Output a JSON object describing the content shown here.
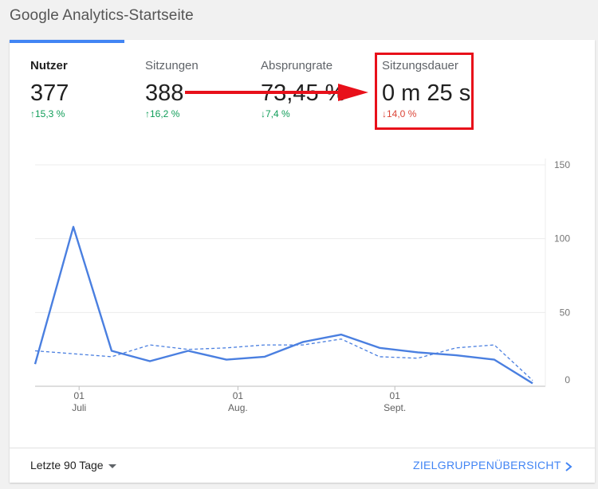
{
  "page": {
    "title": "Google Analytics-Startseite"
  },
  "metrics": [
    {
      "label": "Nutzer",
      "value": "377",
      "change": "15,3 %",
      "direction": "up",
      "active": true
    },
    {
      "label": "Sitzungen",
      "value": "388",
      "change": "16,2 %",
      "direction": "up",
      "active": false
    },
    {
      "label": "Absprungrate",
      "value": "73,45 %",
      "change": "7,4 %",
      "direction": "down",
      "active": false
    },
    {
      "label": "Sitzungsdauer",
      "value": "0 m 25 s",
      "change": "14,0 %",
      "direction": "down",
      "active": false
    }
  ],
  "icons": {
    "up": "↑",
    "down": "↓",
    "dropdown": "caret-down-icon",
    "next": "chevron-right-icon"
  },
  "colors": {
    "accent": "#4285f4",
    "increase": "#0f9d58",
    "decrease": "#db4437",
    "annotation": "#e8101a"
  },
  "chart_data": {
    "type": "line",
    "y_ticks": [
      "150",
      "100",
      "50",
      "0"
    ],
    "ylim": [
      0,
      150
    ],
    "x_ticks": [
      {
        "day": "01",
        "month": "Juli",
        "index": 1.15
      },
      {
        "day": "01",
        "month": "Aug.",
        "index": 5.3
      },
      {
        "day": "01",
        "month": "Sept.",
        "index": 9.4
      }
    ],
    "series": [
      {
        "style": "solid",
        "values": [
          15,
          108,
          24,
          17,
          24,
          18,
          20,
          30,
          35,
          26,
          23,
          21,
          18,
          2
        ]
      },
      {
        "style": "dashed",
        "values": [
          24,
          22,
          20,
          28,
          25,
          26,
          28,
          28,
          32,
          20,
          19,
          26,
          28,
          4
        ]
      }
    ],
    "grid": true
  },
  "footer": {
    "date_range": "Letzte 90 Tage",
    "link": "ZIELGRUPPENÜBERSICHT"
  }
}
